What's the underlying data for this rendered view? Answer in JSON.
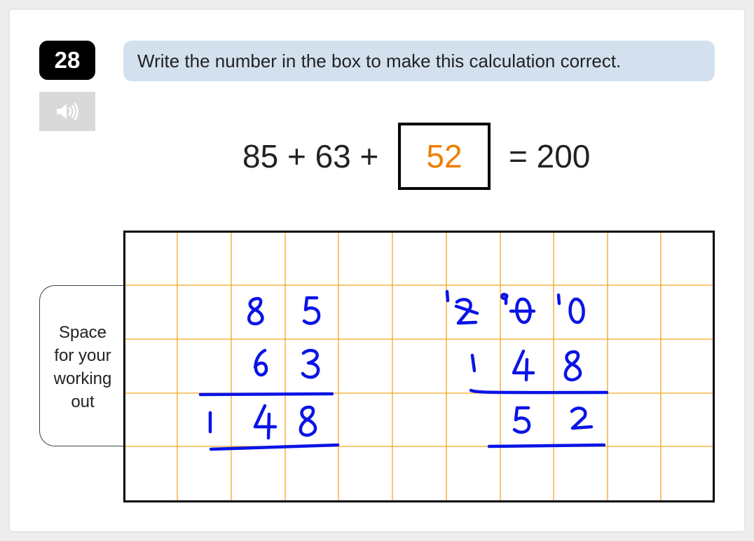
{
  "question": {
    "number": "28",
    "prompt": "Write the number in the box to make this calculation correct."
  },
  "audio": {
    "icon": "speaker-icon"
  },
  "equation": {
    "left": "85 + 63 +",
    "answer": "52",
    "right": "= 200"
  },
  "working": {
    "label_lines": [
      "Space",
      "for your",
      "working",
      "out"
    ]
  },
  "colors": {
    "question_number_bg": "#000000",
    "prompt_bg": "#d3e1ef",
    "answer_text": "#ee7e00",
    "grid_lines": "#f5a623",
    "handwriting": "#0a14e6"
  }
}
